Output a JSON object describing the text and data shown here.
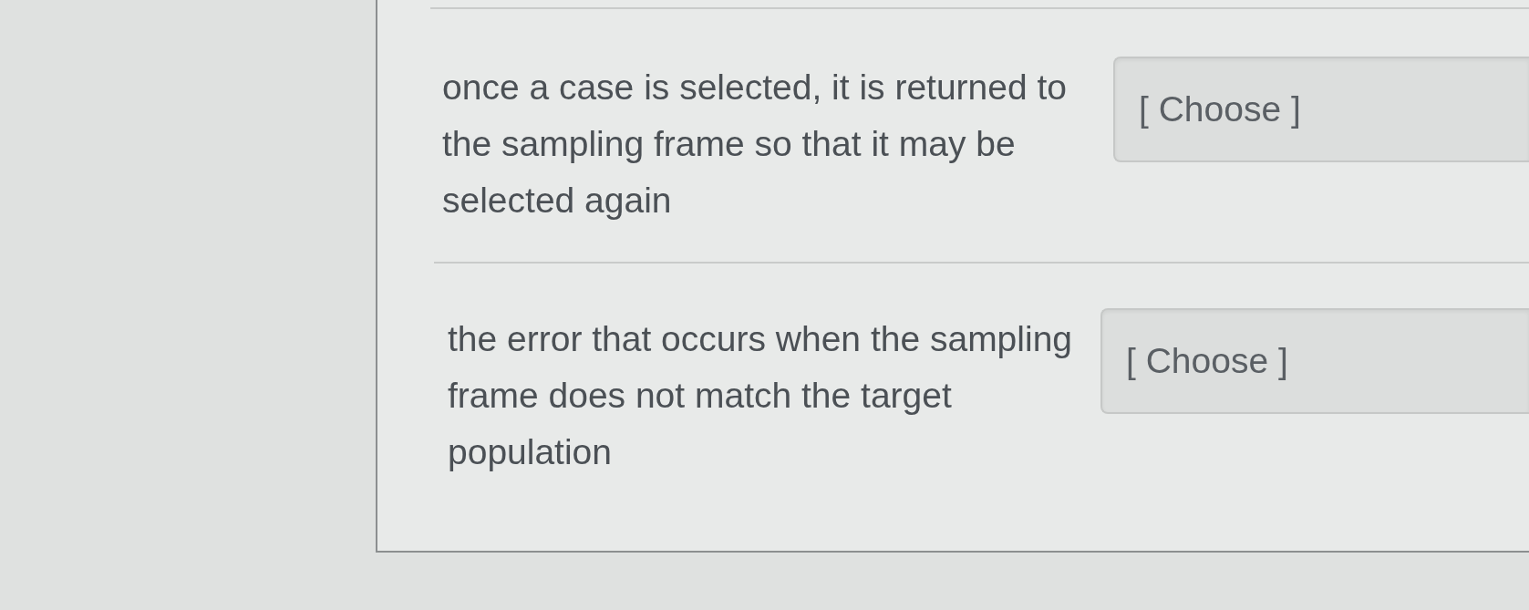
{
  "questions": [
    {
      "prompt": "once a case is selected, it is returned to the sampling frame so that it may be selected again",
      "dropdown": {
        "value": "[ Choose ]"
      }
    },
    {
      "prompt": "the error that occurs when the sampling frame does not match the target population",
      "dropdown": {
        "value": "[ Choose ]"
      }
    }
  ]
}
